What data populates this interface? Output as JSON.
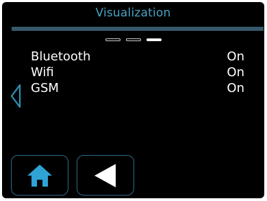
{
  "header": {
    "title": "Visualization"
  },
  "pager": {
    "page_count": 3,
    "active_page": 3
  },
  "settings": {
    "rows": [
      {
        "label": "Bluetooth",
        "value": "On"
      },
      {
        "label": "Wifi",
        "value": "On"
      },
      {
        "label": "GSM",
        "value": "On"
      }
    ]
  },
  "navigation": {
    "home_icon": "home-icon",
    "back_icon": "back-triangle-icon",
    "left_arrow_icon": "chevron-left-icon"
  },
  "colors": {
    "accent": "#4aa3c2",
    "title_bar": "#37596a",
    "button_border": "#2e6c86",
    "text": "#ffffff",
    "background": "#000000"
  }
}
